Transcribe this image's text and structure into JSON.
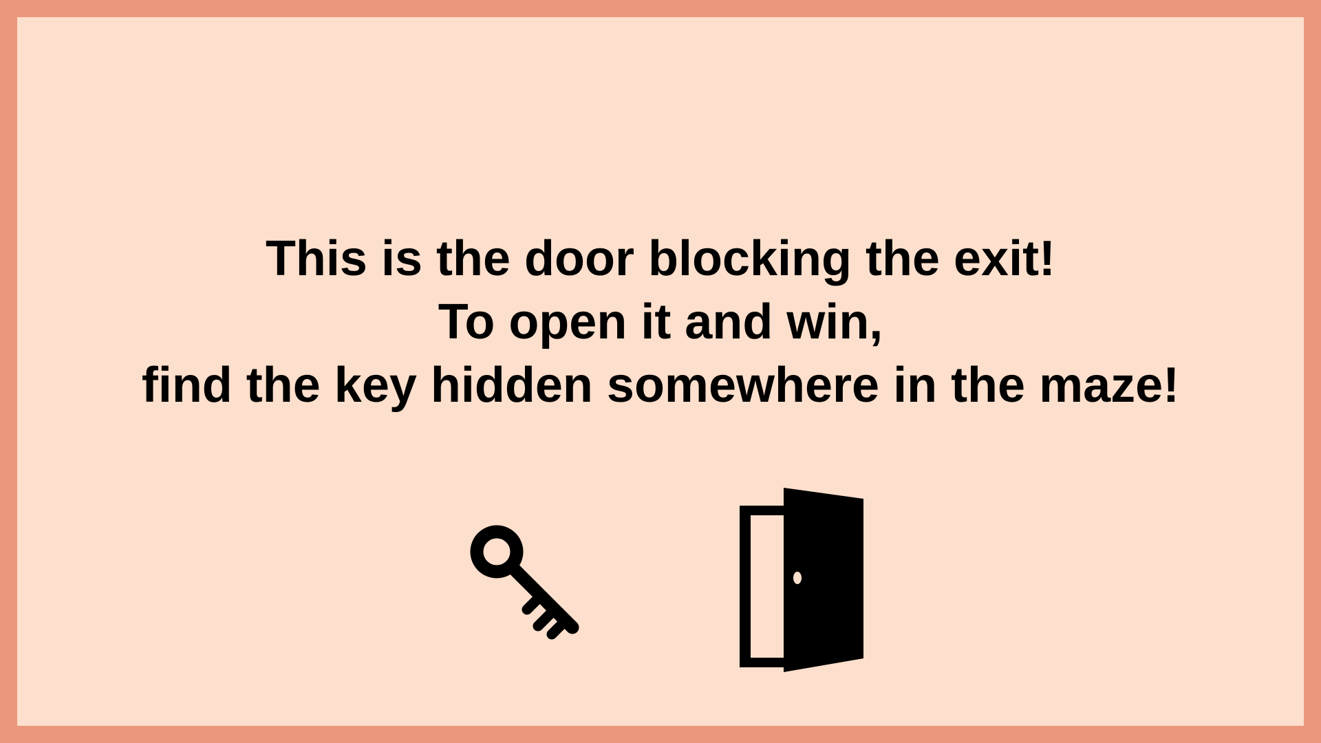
{
  "screen": {
    "background_color": "#FCDFCC",
    "border_color": "#EB977B"
  },
  "message": {
    "line1": "This is the door blocking the exit!",
    "line2": "To open it and win,",
    "line3": "find the key hidden somewhere in the maze!"
  },
  "icons": {
    "key": "key-icon",
    "door": "open-door-icon"
  }
}
